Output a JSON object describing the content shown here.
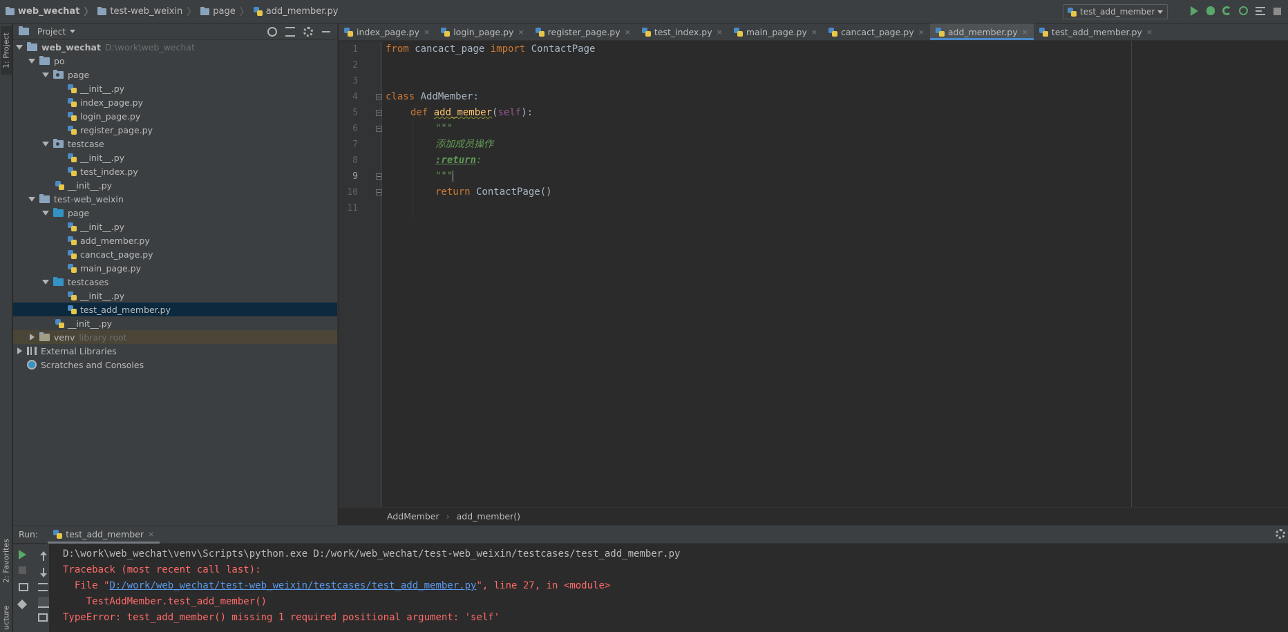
{
  "navbar": {
    "crumbs": [
      "web_wechat",
      "test-web_weixin",
      "page",
      "add_member.py"
    ],
    "run_config": "test_add_member"
  },
  "left_strip": {
    "project_tab": "1: Project",
    "favorites_tab": "2: Favorites",
    "structure_tab": "ucture"
  },
  "project": {
    "title": "Project",
    "tree": [
      {
        "label": "web_wechat",
        "hint": "D:\\work\\web_wechat"
      },
      {
        "label": "po"
      },
      {
        "label": "page"
      },
      {
        "label": "__init__.py"
      },
      {
        "label": "index_page.py"
      },
      {
        "label": "login_page.py"
      },
      {
        "label": "register_page.py"
      },
      {
        "label": "testcase"
      },
      {
        "label": "__init__.py"
      },
      {
        "label": "test_index.py"
      },
      {
        "label": "__init__.py"
      },
      {
        "label": "test-web_weixin"
      },
      {
        "label": "page"
      },
      {
        "label": "__init__.py"
      },
      {
        "label": "add_member.py"
      },
      {
        "label": "cancact_page.py"
      },
      {
        "label": "main_page.py"
      },
      {
        "label": "testcases"
      },
      {
        "label": "__init__.py"
      },
      {
        "label": "test_add_member.py"
      },
      {
        "label": "__init__.py"
      },
      {
        "label": "venv",
        "hint": "library root"
      },
      {
        "label": "External Libraries"
      },
      {
        "label": "Scratches and Consoles"
      }
    ]
  },
  "tabs": [
    {
      "label": "index_page.py"
    },
    {
      "label": "login_page.py"
    },
    {
      "label": "register_page.py"
    },
    {
      "label": "test_index.py"
    },
    {
      "label": "main_page.py"
    },
    {
      "label": "cancact_page.py"
    },
    {
      "label": "add_member.py"
    },
    {
      "label": "test_add_member.py"
    }
  ],
  "tab_close": "×",
  "editor": {
    "line_numbers": [
      "1",
      "2",
      "3",
      "4",
      "5",
      "6",
      "7",
      "8",
      "9",
      "10",
      "11"
    ],
    "code": {
      "l1_from": "from",
      "l1_mod": " cancact_page ",
      "l1_import": "import",
      "l1_name": " ContactPage",
      "l4_class": "class",
      "l4_name": " AddMember:",
      "l5_def": "def",
      "l5_fn": "add_member",
      "l5_open": "(",
      "l5_self": "self",
      "l5_close": "):",
      "l6": "\"\"\"",
      "l7": "添加成员操作",
      "l8_tag": ":return",
      "l8_colon": ":",
      "l9": "\"\"\"",
      "l10_return": "return",
      "l10_call": " ContactPage()"
    },
    "breadcrumb": [
      "AddMember",
      "add_member()"
    ]
  },
  "run": {
    "label": "Run:",
    "tab": "test_add_member",
    "console": {
      "cmd": "D:\\work\\web_wechat\\venv\\Scripts\\python.exe D:/work/web_wechat/test-web_weixin/testcases/test_add_member.py",
      "traceback": "Traceback (most recent call last):",
      "file_prefix": "  File \"",
      "file_link": "D:/work/web_wechat/test-web_weixin/testcases/test_add_member.py",
      "file_suffix": "\", line 27, in <module>",
      "call": "    TestAddMember.test_add_member()",
      "error": "TypeError: test_add_member() missing 1 required positional argument: 'self'"
    }
  }
}
